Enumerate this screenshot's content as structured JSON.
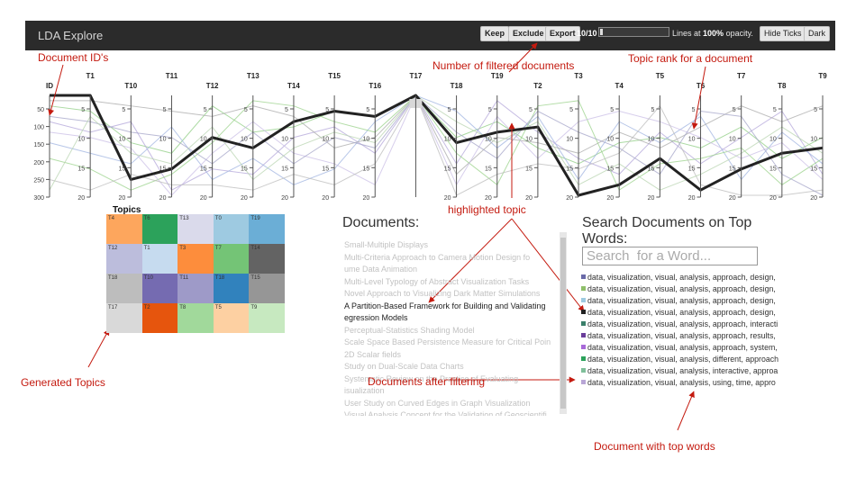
{
  "header": {
    "title": "LDA Explore",
    "keep_label": "Keep",
    "exclude_label": "Exclude",
    "export_label": "Export",
    "filtered_count": "10/10",
    "opacity_prefix": "Lines at ",
    "opacity_value": "100%",
    "opacity_suffix": " opacity.",
    "hide_ticks_label": "Hide Ticks",
    "dark_label": "Dark"
  },
  "parallel_coords": {
    "axes": [
      {
        "label": "ID",
        "ticks": [
          "50",
          "100",
          "150",
          "200",
          "250",
          "300"
        ]
      },
      {
        "label": "T1",
        "ticks": [
          "5",
          "10",
          "15",
          "20"
        ]
      },
      {
        "label": "T10",
        "ticks": [
          "5",
          "10",
          "15",
          "20"
        ]
      },
      {
        "label": "T11",
        "ticks": [
          "5",
          "10",
          "15",
          "20"
        ]
      },
      {
        "label": "T12",
        "ticks": [
          "5",
          "10",
          "15",
          "20"
        ]
      },
      {
        "label": "T13",
        "ticks": [
          "5",
          "10",
          "15",
          "20"
        ]
      },
      {
        "label": "T14",
        "ticks": [
          "5",
          "10",
          "15",
          "20"
        ]
      },
      {
        "label": "T15",
        "ticks": [
          "5",
          "10",
          "15",
          "20"
        ]
      },
      {
        "label": "T16",
        "ticks": [
          "5",
          "10",
          "15",
          "20"
        ]
      },
      {
        "label": "T17",
        "ticks": []
      },
      {
        "label": "T18",
        "ticks": [
          "5",
          "10",
          "15",
          "20"
        ]
      },
      {
        "label": "T19",
        "ticks": [
          "5",
          "10",
          "15",
          "20"
        ]
      },
      {
        "label": "T2",
        "ticks": [
          "5",
          "10",
          "15",
          "20"
        ]
      },
      {
        "label": "T3",
        "ticks": [
          "5",
          "10",
          "15",
          "20"
        ]
      },
      {
        "label": "T4",
        "ticks": [
          "5",
          "10",
          "15",
          "20"
        ]
      },
      {
        "label": "T5",
        "ticks": [
          "5",
          "10",
          "15",
          "20"
        ]
      },
      {
        "label": "T6",
        "ticks": [
          "5",
          "10",
          "15",
          "20"
        ]
      },
      {
        "label": "T7",
        "ticks": [
          "5",
          "10",
          "15",
          "20"
        ]
      },
      {
        "label": "T8",
        "ticks": [
          "5",
          "10",
          "15",
          "20"
        ]
      },
      {
        "label": "T9",
        "ticks": [
          "5",
          "10",
          "15",
          "20"
        ]
      }
    ],
    "highlighted_ranks": [
      1,
      1,
      17,
      15,
      9,
      11,
      6,
      4,
      5,
      1,
      10,
      8,
      7,
      20,
      18,
      13,
      19,
      15,
      12,
      11
    ],
    "background_lines": [
      {
        "color": "#8fce83",
        "ranks": [
          3,
          4,
          10,
          12,
          3,
          8,
          7,
          4,
          5,
          1,
          9,
          6,
          11,
          14,
          10,
          9,
          11,
          7,
          13,
          9
        ]
      },
      {
        "color": "#b3a6d9",
        "ranks": [
          6,
          8,
          6,
          19,
          15,
          16,
          9,
          7,
          12,
          1,
          14,
          2,
          8,
          13,
          16,
          8,
          14,
          9,
          4,
          16
        ]
      },
      {
        "color": "#9fb3e0",
        "ranks": [
          10,
          12,
          14,
          7,
          17,
          13,
          18,
          15,
          6,
          1,
          4,
          11,
          5,
          17,
          6,
          10,
          5,
          17,
          8,
          14
        ]
      },
      {
        "color": "#aaaaaa",
        "ranks": [
          2,
          2,
          3,
          4,
          5,
          3,
          5,
          11,
          9,
          1,
          16,
          9,
          10,
          12,
          8,
          11,
          7,
          3,
          6,
          3
        ]
      },
      {
        "color": "#9ad18a",
        "ranks": [
          13,
          15,
          19,
          16,
          10,
          2,
          3,
          6,
          8,
          1,
          12,
          18,
          3,
          2,
          19,
          14,
          13,
          11,
          18,
          13
        ]
      },
      {
        "color": "#c9bde6",
        "ranks": [
          8,
          9,
          11,
          20,
          12,
          6,
          12,
          14,
          18,
          1,
          18,
          5,
          13,
          6,
          4,
          6,
          9,
          13,
          10,
          17
        ]
      },
      {
        "color": "#bbbbbb",
        "ranks": [
          17,
          19,
          16,
          18,
          18,
          19,
          16,
          18,
          14,
          1,
          20,
          16,
          14,
          15,
          12,
          3,
          18,
          20,
          20,
          19
        ]
      },
      {
        "color": "#a4a4c8",
        "ranks": [
          5,
          6,
          8,
          9,
          14,
          8,
          14,
          9,
          11,
          1,
          8,
          13,
          4,
          8,
          11,
          16,
          4,
          5,
          16,
          20
        ]
      },
      {
        "color": "#b8d4b0",
        "ranks": [
          19,
          5,
          12,
          14,
          7,
          17,
          11,
          8,
          10,
          1,
          6,
          10,
          6,
          18,
          14,
          19,
          16,
          12,
          7,
          12
        ]
      }
    ],
    "colors": {
      "highlight": "#222222",
      "axis": "#555555",
      "brush": "#d8d8d8"
    }
  },
  "topics": {
    "heading": "Topics",
    "cells": [
      {
        "label": "T4",
        "color": "#fda65d"
      },
      {
        "label": "T6",
        "color": "#2ca25b"
      },
      {
        "label": "T13",
        "color": "#dadaeb"
      },
      {
        "label": "T0",
        "color": "#9ecae1"
      },
      {
        "label": "T19",
        "color": "#6baed6"
      },
      {
        "label": "T12",
        "color": "#bcbddc"
      },
      {
        "label": "T1",
        "color": "#c6dbef"
      },
      {
        "label": "T3",
        "color": "#fd8d3c"
      },
      {
        "label": "T7",
        "color": "#74c476"
      },
      {
        "label": "T14",
        "color": "#636363"
      },
      {
        "label": "T18",
        "color": "#bdbdbd"
      },
      {
        "label": "T10",
        "color": "#756bb1"
      },
      {
        "label": "T11",
        "color": "#9e9ac8"
      },
      {
        "label": "T18",
        "color": "#3182bd"
      },
      {
        "label": "T15",
        "color": "#969696"
      },
      {
        "label": "T17",
        "color": "#d9d9d9"
      },
      {
        "label": "T2",
        "color": "#e6550d"
      },
      {
        "label": "T8",
        "color": "#a1d99b"
      },
      {
        "label": "T5",
        "color": "#fdd0a2"
      },
      {
        "label": "T9",
        "color": "#c7e9c0"
      }
    ]
  },
  "documents": {
    "heading": "Documents:",
    "items": [
      {
        "text": "Small-Multiple Displays",
        "highlighted": false
      },
      {
        "text": "Multi-Criteria Approach to Camera Motion Design fo",
        "highlighted": false
      },
      {
        "text": "ume Data Animation",
        "highlighted": false
      },
      {
        "text": "Multi-Level Typology of Abstract Visualization Tasks",
        "highlighted": false
      },
      {
        "text": "Novel Approach to Visualizing Dark Matter Simulations",
        "highlighted": false
      },
      {
        "text": "A Partition-Based Framework for Building and Validating",
        "highlighted": true
      },
      {
        "text": "egression Models",
        "highlighted": true
      },
      {
        "text": "Perceptual-Statistics Shading Model",
        "highlighted": false
      },
      {
        "text": "Scale Space Based Persistence Measure for Critical Poin",
        "highlighted": false
      },
      {
        "text": "2D Scalar fields",
        "highlighted": false
      },
      {
        "text": "Study on Dual-Scale Data Charts",
        "highlighted": false
      },
      {
        "text": "Systematic Review on the Practice of Evaluating",
        "highlighted": false
      },
      {
        "text": "isualization",
        "highlighted": false
      },
      {
        "text": "User Study on Curved Edges in Graph Visualization",
        "highlighted": false
      },
      {
        "text": "Visual Analysis Concept for the Validation of Geoscientifi",
        "highlighted": false
      }
    ]
  },
  "search": {
    "heading": "Search Documents on Top Words:",
    "placeholder": "Search  for a Word...",
    "results": [
      {
        "color": "#6a6aa8",
        "text": "data, visualization, visual, analysis, approach, design,"
      },
      {
        "color": "#8fbf6a",
        "text": "data, visualization, visual, analysis, approach, design,"
      },
      {
        "color": "#9ecae1",
        "text": "data, visualization, visual, analysis, approach, design,"
      },
      {
        "color": "#222222",
        "text": "data, visualization, visual, analysis, approach, design,"
      },
      {
        "color": "#3a7f6a",
        "text": "data, visualization, visual, analysis, approach, interacti"
      },
      {
        "color": "#6a3d9a",
        "text": "data, visualization, visual, analysis, approach, results,"
      },
      {
        "color": "#a86ad8",
        "text": "data, visualization, visual, analysis, approach, system,"
      },
      {
        "color": "#2ca25b",
        "text": "data, visualization, visual, analysis, different, approach"
      },
      {
        "color": "#7fbf9a",
        "text": "data, visualization, visual, analysis, interactive, approa"
      },
      {
        "color": "#b8a6d6",
        "text": "data, visualization, visual, analysis, using, time, appro"
      }
    ]
  },
  "annotations": {
    "document_ids": "Document ID's",
    "filtered_docs": "Number of filtered documents",
    "topic_rank": "Topic rank for a document",
    "highlighted_topic": "highlighted topic",
    "generated_topics": "Generated Topics",
    "docs_after_filtering": "Documents after filtering",
    "doc_top_words": "Document with top words"
  }
}
